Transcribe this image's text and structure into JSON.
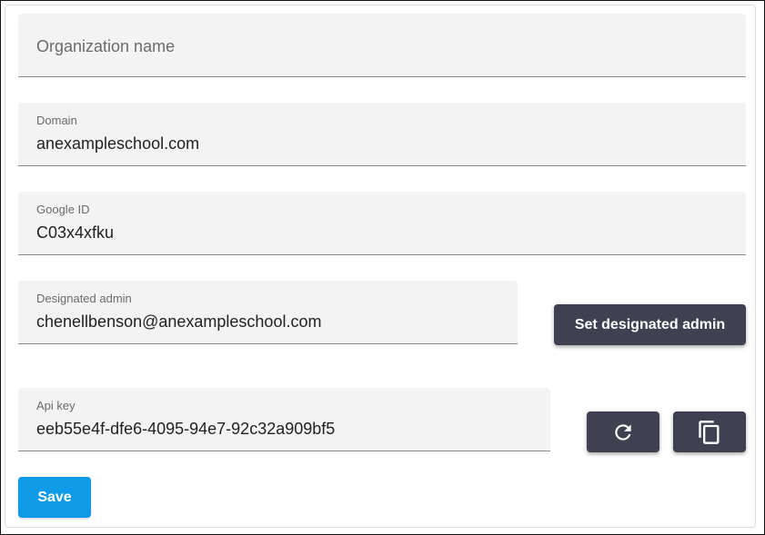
{
  "form": {
    "organization_name": {
      "placeholder": "Organization name",
      "value": ""
    },
    "domain": {
      "label": "Domain",
      "value": "anexampleschool.com"
    },
    "google_id": {
      "label": "Google ID",
      "value": "C03x4xfku"
    },
    "designated_admin": {
      "label": "Designated admin",
      "value": "chenellbenson@anexampleschool.com"
    },
    "api_key": {
      "label": "Api key",
      "value": "eeb55e4f-dfe6-4095-94e7-92c32a909bf5"
    }
  },
  "buttons": {
    "set_designated_admin": "Set designated admin",
    "save": "Save",
    "regenerate_icon": "refresh-icon",
    "copy_icon": "copy-icon"
  },
  "colors": {
    "primary": "#0f9be8",
    "secondary_button": "#3f4150",
    "field_bg": "#f3f3f3"
  }
}
